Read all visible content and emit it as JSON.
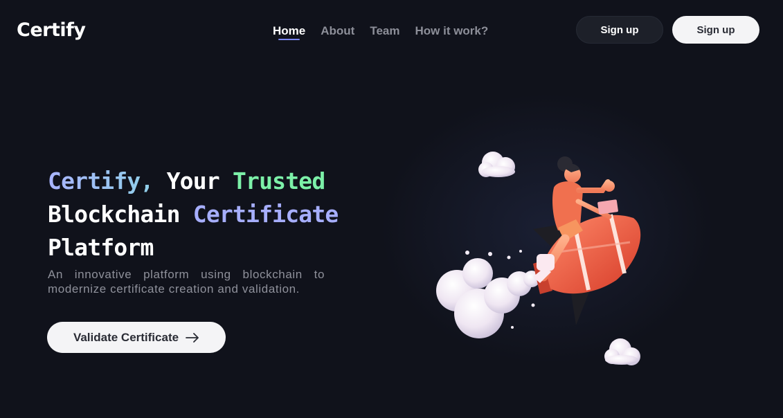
{
  "brand": {
    "name": "Certify"
  },
  "nav": {
    "items": [
      {
        "label": "Home",
        "active": true
      },
      {
        "label": "About",
        "active": false
      },
      {
        "label": "Team",
        "active": false
      },
      {
        "label": "How it work?",
        "active": false
      }
    ]
  },
  "header": {
    "signup_dark_label": "Sign up",
    "signup_light_label": "Sign up"
  },
  "hero": {
    "headline": {
      "part1": "Certify,",
      "part2": " Your ",
      "part3": "Trusted",
      "part4": "Blockchain ",
      "part5": "Certificate",
      "part6": "Platform"
    },
    "subtext": "An innovative platform using blockchain to modernize certificate creation and validation.",
    "cta_label": "Validate Certificate",
    "cta_icon": "arrow-right-icon"
  },
  "illustration": {
    "subject": "person-riding-rocket-with-laptop"
  },
  "colors": {
    "background": "#10121b",
    "accent_underline": "#7b86f5",
    "headline_green": "#7cf0a8",
    "headline_purple": "#a6aefc",
    "rocket": "#f2603f"
  }
}
